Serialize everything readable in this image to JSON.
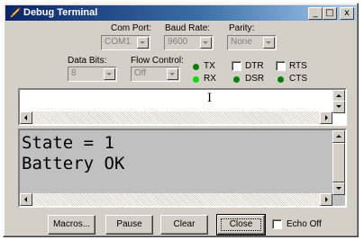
{
  "window": {
    "title": "Debug Terminal",
    "minimize": "_",
    "maximize": "□",
    "close": "x"
  },
  "settings": {
    "com_port": {
      "label": "Com Port:",
      "value": "COM1"
    },
    "baud_rate": {
      "label": "Baud Rate:",
      "value": "9600"
    },
    "parity": {
      "label": "Parity:",
      "value": "None"
    },
    "data_bits": {
      "label": "Data Bits:",
      "value": "8"
    },
    "flow_control": {
      "label": "Flow Control:",
      "value": "Off"
    }
  },
  "signals": {
    "tx": {
      "label": "TX",
      "color": "#008000"
    },
    "rx": {
      "label": "RX",
      "color": "#00e000"
    },
    "dtr": {
      "label": "DTR",
      "checked": false
    },
    "rts": {
      "label": "RTS",
      "checked": false
    },
    "dsr": {
      "label": "DSR",
      "color": "#008000"
    },
    "cts": {
      "label": "CTS",
      "color": "#008000"
    }
  },
  "input_text": "",
  "output": {
    "lines": [
      "State = 1",
      "Battery OK"
    ]
  },
  "buttons": {
    "macros": "Macros...",
    "pause": "Pause",
    "clear": "Clear",
    "close": "Close",
    "echo_off": "Echo Off"
  },
  "colors": {
    "output_bg": "#c0c0c0",
    "title_start": "#0a246a",
    "title_end": "#a6caf0"
  }
}
